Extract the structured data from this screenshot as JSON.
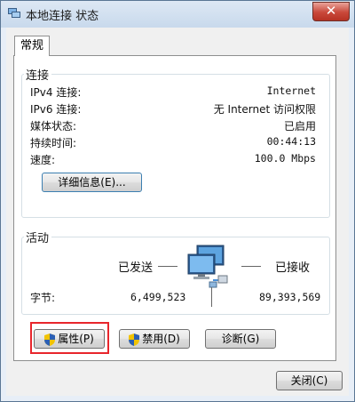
{
  "window": {
    "title": "本地连接 状态",
    "close_glyph": "✕"
  },
  "tabs": [
    {
      "label": "常规"
    }
  ],
  "connection": {
    "group_label": "连接",
    "rows": [
      {
        "label": "IPv4 连接:",
        "value": "Internet"
      },
      {
        "label": "IPv6 连接:",
        "value": "无 Internet 访问权限"
      },
      {
        "label": "媒体状态:",
        "value": "已启用"
      },
      {
        "label": "持续时间:",
        "value": "00:44:13"
      },
      {
        "label": "速度:",
        "value": "100.0 Mbps"
      }
    ],
    "details_button": "详细信息(E)..."
  },
  "activity": {
    "group_label": "活动",
    "sent_label": "已发送",
    "received_label": "已接收",
    "bytes_label": "字节:",
    "bytes_sent": "6,499,523",
    "bytes_received": "89,393,569",
    "icon": "network-computers-icon"
  },
  "buttons": {
    "properties": "属性(P)",
    "disable": "禁用(D)",
    "diagnose": "诊断(G)",
    "close": "关闭(C)"
  },
  "colors": {
    "highlight_box": "#e8262c",
    "title_bar": "#c8d9ec",
    "close_button": "#c9483a"
  }
}
